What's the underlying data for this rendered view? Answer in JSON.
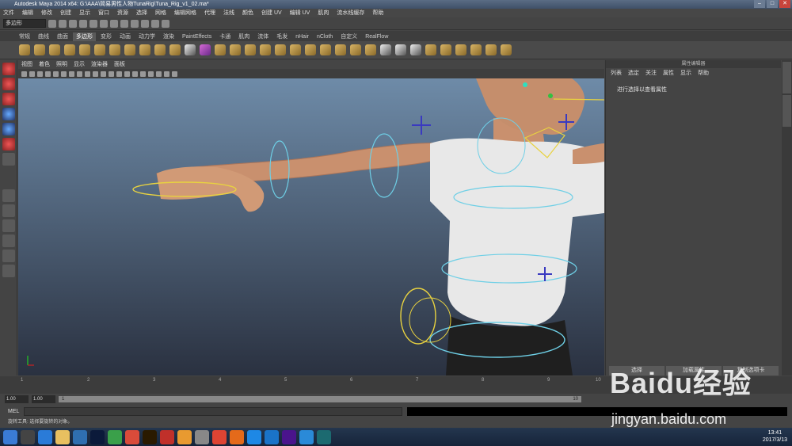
{
  "window": {
    "title": "Autodesk Maya 2014 x64: G:\\AAA\\简易男性人物TunaRig\\Tuna_Rig_v1_02.ma*",
    "min": "–",
    "max": "□",
    "close": "✕"
  },
  "menubar": [
    "文件",
    "编辑",
    "修改",
    "创建",
    "显示",
    "窗口",
    "资源",
    "选择",
    "网格",
    "编辑网格",
    "代理",
    "法线",
    "颜色",
    "创建 UV",
    "编辑 UV",
    "肌肉",
    "流水线缓存",
    "帮助"
  ],
  "status": {
    "mode": "多边形"
  },
  "shelf_tabs": [
    "常规",
    "曲线",
    "曲面",
    "多边形",
    "变形",
    "动画",
    "动力学",
    "渲染",
    "PaintEffects",
    "卡通",
    "肌肉",
    "流体",
    "毛发",
    "nHair",
    "nCloth",
    "自定义",
    "RealFlow"
  ],
  "active_shelf_tab": "多边形",
  "view_menu": [
    "视图",
    "着色",
    "照明",
    "显示",
    "渲染器",
    "面板"
  ],
  "attr_editor": {
    "header": "属性编辑器",
    "menus": [
      "列表",
      "选定",
      "关注",
      "属性",
      "显示",
      "帮助"
    ],
    "message": "进行选择以查看属性",
    "buttons": [
      "选择",
      "加载属性",
      "复制选项卡"
    ]
  },
  "timeline": {
    "ticks": [
      "1",
      "2",
      "3",
      "4",
      "5",
      "6",
      "7",
      "8",
      "9",
      "10"
    ],
    "end": "10"
  },
  "range": {
    "start": "1.00",
    "start2": "1.00",
    "current": "1",
    "end": "10"
  },
  "mel_label": "MEL",
  "help_line": "旋转工具: 选择要旋转的对象。",
  "clock": {
    "time": "13:41",
    "date": "2017/3/13"
  },
  "watermark": {
    "brand": "Baidu经验",
    "url": "jingyan.baidu.com"
  }
}
